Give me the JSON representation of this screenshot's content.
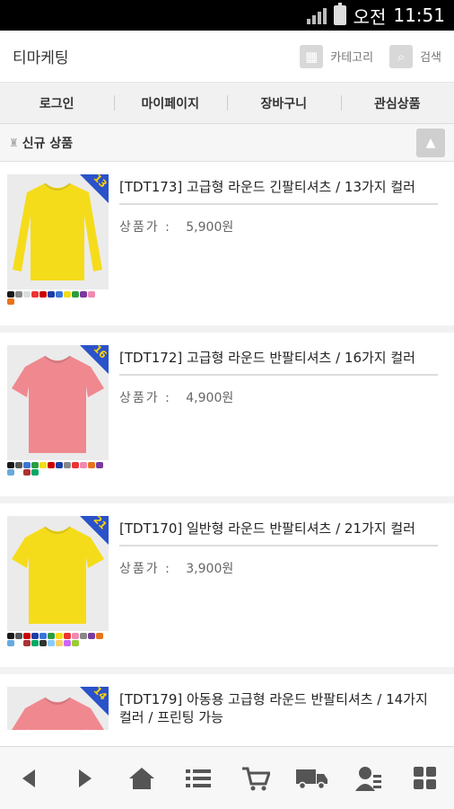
{
  "status_bar": {
    "ampm": "오전",
    "time": "11:51"
  },
  "header": {
    "logo": "티마케팅",
    "category_label": "카테고리",
    "search_label": "검색"
  },
  "nav": {
    "login": "로그인",
    "mypage": "마이페이지",
    "cart": "장바구니",
    "wishlist": "관심상품"
  },
  "section": {
    "title": "신규 상품"
  },
  "price_label": "상품가 :",
  "products": [
    {
      "name": "[TDT173] 고급형 라운드 긴팔티셔츠 / 13가지 컬러",
      "price": "5,900원",
      "badge": "13",
      "color": "#f5dc1a",
      "sleeve": "long",
      "swatches": [
        "#1a1a1a",
        "#888",
        "#ddd",
        "#e33",
        "#c00",
        "#1a3ea8",
        "#3a76d8",
        "#f5dc1a",
        "#2b9e3e",
        "#7a3a9e",
        "#f08ab0",
        "#fff",
        "#e8731b"
      ]
    },
    {
      "name": "[TDT172] 고급형 라운드 반팔티셔츠 / 16가지 컬러",
      "price": "4,900원",
      "badge": "16",
      "color": "#f0888f",
      "sleeve": "short",
      "swatches": [
        "#1a1a1a",
        "#555",
        "#3a76d8",
        "#2b9e3e",
        "#f5dc1a",
        "#c00",
        "#1a3ea8",
        "#888",
        "#e33",
        "#f08ab0",
        "#e8731b",
        "#7a3a9e",
        "#6ad",
        "#fff",
        "#a33",
        "#0a6"
      ]
    },
    {
      "name": "[TDT170] 일반형 라운드 반팔티셔츠 / 21가지 컬러",
      "price": "3,900원",
      "badge": "21",
      "color": "#f5dc1a",
      "sleeve": "short",
      "swatches": [
        "#1a1a1a",
        "#555",
        "#c00",
        "#1a3ea8",
        "#3a76d8",
        "#2b9e3e",
        "#f5dc1a",
        "#e33",
        "#f08ab0",
        "#888",
        "#7a3a9e",
        "#e8731b",
        "#6ad",
        "#fff",
        "#a33",
        "#0a6",
        "#333",
        "#8cf",
        "#fc6",
        "#c6f",
        "#9c3"
      ]
    },
    {
      "name": "[TDT179] 아동용 고급형 라운드 반팔티셔츠 / 14가지 컬러 / 프린팅 가능",
      "price": "",
      "badge": "14",
      "color": "#f0888f",
      "sleeve": "short",
      "swatches": []
    }
  ],
  "bottom_nav": [
    "back-icon",
    "forward-icon",
    "home-icon",
    "list-icon",
    "cart-icon",
    "delivery-icon",
    "member-icon",
    "grid-icon"
  ]
}
